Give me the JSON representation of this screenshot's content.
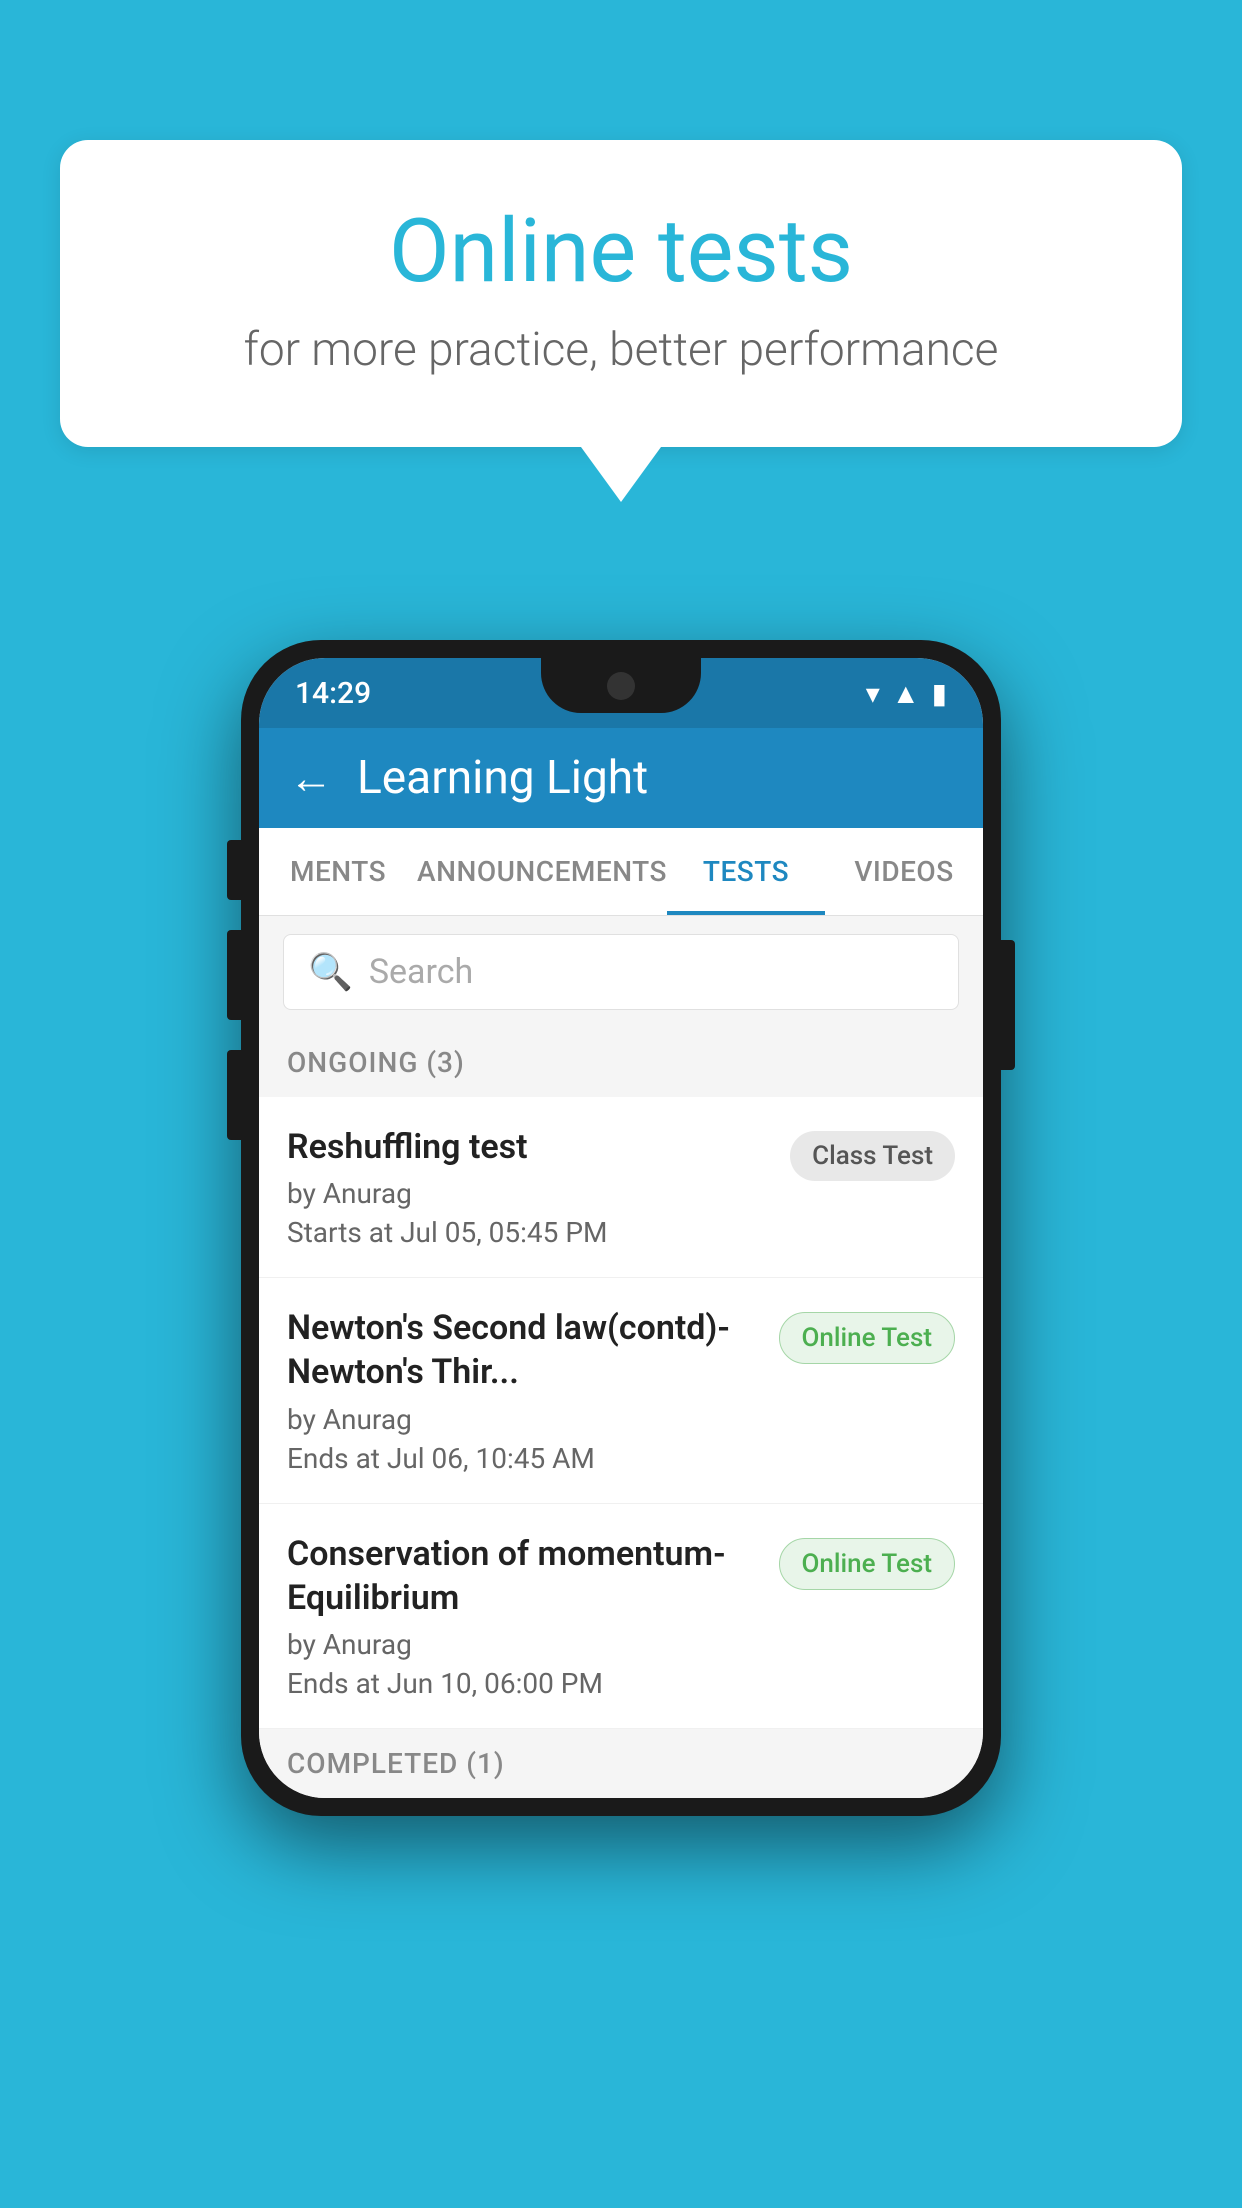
{
  "background_color": "#29b6d8",
  "speech_bubble": {
    "title": "Online tests",
    "subtitle": "for more practice, better performance"
  },
  "phone": {
    "status_bar": {
      "time": "14:29",
      "icons": [
        "wifi",
        "signal",
        "battery"
      ]
    },
    "app_bar": {
      "back_label": "←",
      "title": "Learning Light"
    },
    "tabs": [
      {
        "label": "MENTS",
        "active": false
      },
      {
        "label": "ANNOUNCEMENTS",
        "active": false
      },
      {
        "label": "TESTS",
        "active": true
      },
      {
        "label": "VIDEOS",
        "active": false
      }
    ],
    "search": {
      "placeholder": "Search"
    },
    "sections": [
      {
        "header": "ONGOING (3)",
        "items": [
          {
            "name": "Reshuffling test",
            "author": "by Anurag",
            "date": "Starts at  Jul 05, 05:45 PM",
            "badge": "Class Test",
            "badge_type": "class"
          },
          {
            "name": "Newton's Second law(contd)-Newton's Thir...",
            "author": "by Anurag",
            "date": "Ends at  Jul 06, 10:45 AM",
            "badge": "Online Test",
            "badge_type": "online"
          },
          {
            "name": "Conservation of momentum-Equilibrium",
            "author": "by Anurag",
            "date": "Ends at  Jun 10, 06:00 PM",
            "badge": "Online Test",
            "badge_type": "online"
          }
        ]
      },
      {
        "header": "COMPLETED (1)",
        "items": []
      }
    ]
  }
}
